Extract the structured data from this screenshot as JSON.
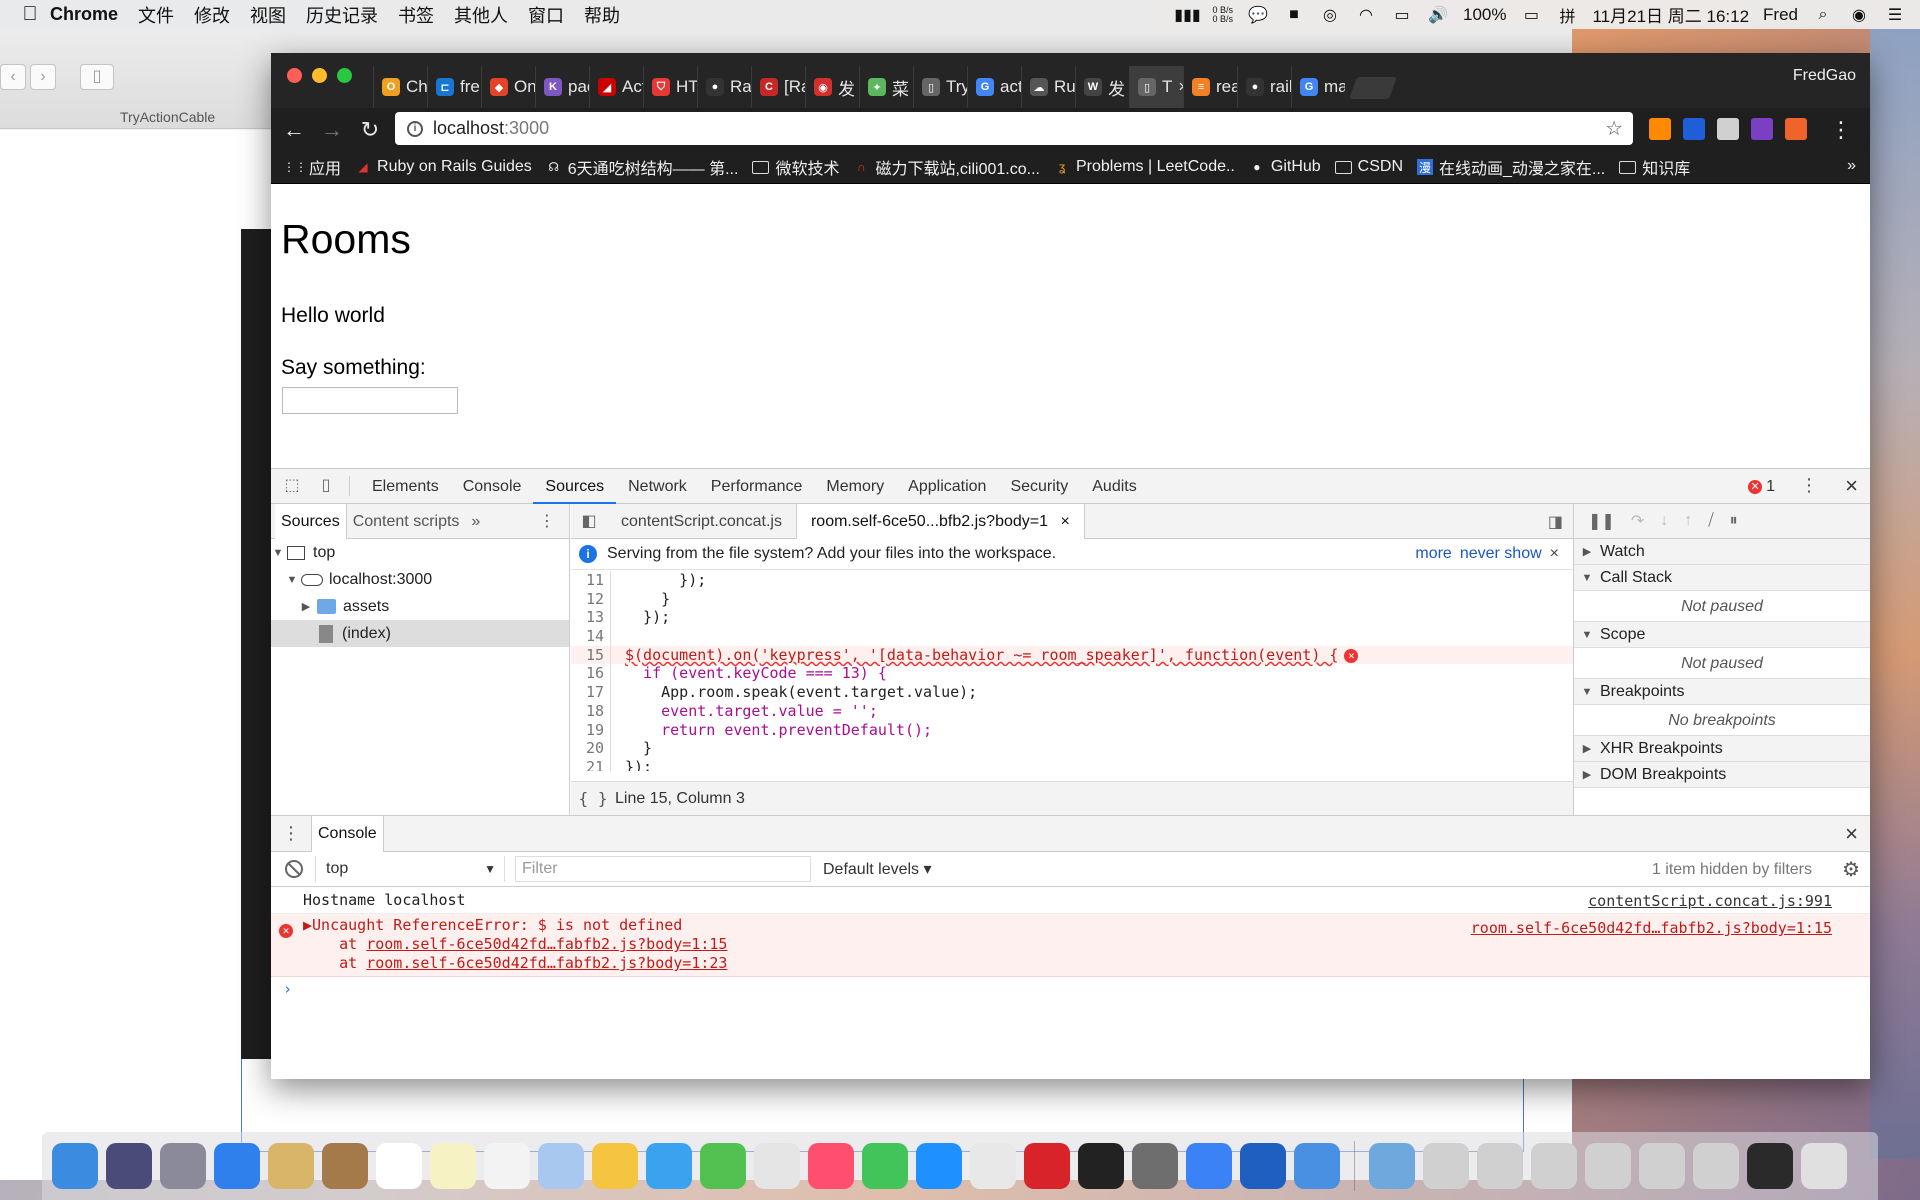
{
  "menubar": {
    "app": "Chrome",
    "items": [
      "文件",
      "修改",
      "视图",
      "历史记录",
      "书签",
      "其他人",
      "窗口",
      "帮助"
    ],
    "netspeed_up": "0 B/s",
    "netspeed_down": "0 B/s",
    "battery": "100%",
    "input_method": "拼",
    "datetime": "11月21日 周二  16:12",
    "user": "Fred"
  },
  "background_window": {
    "title": "TryActionCable"
  },
  "browser": {
    "profile": "FredGao",
    "tabs": [
      {
        "label": "Ch",
        "color": "#f0a020",
        "glyph": "O"
      },
      {
        "label": "fre",
        "color": "#1976d2",
        "glyph": "⊏"
      },
      {
        "label": "Onl",
        "color": "#e24329",
        "glyph": "◆"
      },
      {
        "label": "pac",
        "color": "#7e57c2",
        "glyph": "K"
      },
      {
        "label": "Act",
        "color": "#cc0000",
        "glyph": "◢"
      },
      {
        "label": "HT",
        "color": "#e53935",
        "glyph": "⛉"
      },
      {
        "label": "Rai",
        "color": "#333333",
        "glyph": "●"
      },
      {
        "label": "[Ra",
        "color": "#c62828",
        "glyph": "C"
      },
      {
        "label": "发",
        "color": "#d32f2f",
        "glyph": "◉"
      },
      {
        "label": "菜",
        "color": "#5cb85c",
        "glyph": "✦"
      },
      {
        "label": "Try",
        "color": "#666666",
        "glyph": "▯"
      },
      {
        "label": "act",
        "color": "#4285f4",
        "glyph": "G"
      },
      {
        "label": "Rul",
        "color": "#555555",
        "glyph": "☁"
      },
      {
        "label": "发",
        "color": "#444444",
        "glyph": "W"
      },
      {
        "label": "T",
        "color": "#666666",
        "glyph": "▯",
        "active": true
      },
      {
        "label": "rea",
        "color": "#f48024",
        "glyph": "≡"
      },
      {
        "label": "rail",
        "color": "#333333",
        "glyph": "●"
      },
      {
        "label": "ma",
        "color": "#4285f4",
        "glyph": "G"
      }
    ],
    "url_host": "localhost",
    "url_port": ":3000",
    "bookmarks": [
      {
        "label": "应用",
        "icon": "apps-grid"
      },
      {
        "label": "Ruby on Rails Guides",
        "icon": "rails-icon"
      },
      {
        "label": "6天通吃树结构—— 第...",
        "icon": "tree-icon"
      },
      {
        "label": "微软技术",
        "icon": "folder"
      },
      {
        "label": "磁力下载站,cili001.co...",
        "icon": "magnet-icon"
      },
      {
        "label": "Problems | LeetCode..",
        "icon": "leetcode-icon"
      },
      {
        "label": "GitHub",
        "icon": "github-icon"
      },
      {
        "label": "CSDN",
        "icon": "folder"
      },
      {
        "label": "在线动画_动漫之家在...",
        "icon": "anime-icon"
      },
      {
        "label": "知识库",
        "icon": "folder"
      }
    ]
  },
  "page": {
    "heading": "Rooms",
    "p1": "Hello world",
    "p2": "Say something:"
  },
  "devtools": {
    "tabs": [
      "Elements",
      "Console",
      "Sources",
      "Network",
      "Performance",
      "Memory",
      "Application",
      "Security",
      "Audits"
    ],
    "active_tab": "Sources",
    "error_count": "1",
    "nav_tabs": [
      "Sources",
      "Content scripts"
    ],
    "tree": {
      "top": "top",
      "host": "localhost:3000",
      "assets": "assets",
      "index": "(index)"
    },
    "editor_tabs": [
      "contentScript.concat.js",
      "room.self-6ce50...bfb2.js?body=1"
    ],
    "infobar": {
      "text": "Serving from the file system? Add your files into the workspace.",
      "more": "more",
      "never": "never show"
    },
    "code_lines": [
      {
        "n": "11",
        "text": "      });"
      },
      {
        "n": "12",
        "text": "    }"
      },
      {
        "n": "13",
        "text": "  });"
      },
      {
        "n": "14",
        "text": ""
      },
      {
        "n": "15",
        "text": "$(document).on('keypress', '[data-behavior ~= room_speaker]', function(event) {"
      },
      {
        "n": "16",
        "text": "  if (event.keyCode === 13) {"
      },
      {
        "n": "17",
        "text": "    App.room.speak(event.target.value);"
      },
      {
        "n": "18",
        "text": "    event.target.value = '';"
      },
      {
        "n": "19",
        "text": "    return event.preventDefault();"
      },
      {
        "n": "20",
        "text": "  }"
      },
      {
        "n": "21",
        "text": "});"
      }
    ],
    "status": "Line 15, Column 3",
    "debug": {
      "watch": "Watch",
      "call_stack": "Call Stack",
      "not_paused": "Not paused",
      "scope": "Scope",
      "breakpoints": "Breakpoints",
      "no_breakpoints": "No breakpoints",
      "xhr": "XHR Breakpoints",
      "dom": "DOM Breakpoints"
    },
    "console": {
      "tab": "Console",
      "context": "top",
      "filter_placeholder": "Filter",
      "levels": "Default levels",
      "hidden": "1 item hidden by filters",
      "log_text": "Hostname localhost",
      "log_src": "contentScript.concat.js:991",
      "error_text": "Uncaught ReferenceError: $ is not defined",
      "error_src": "room.self-6ce50d42fd…fabfb2.js?body=1:15",
      "at1_prefix": "    at ",
      "at1": "room.self-6ce50d42fd…fabfb2.js?body=1:15",
      "at2": "room.self-6ce50d42fd…fabfb2.js?body=1:23"
    }
  },
  "dock_colors": [
    "#3b8be0",
    "#4b4b7a",
    "#8a8a9a",
    "#2f80ed",
    "#d9b56a",
    "#a57a4a",
    "#ffffff",
    "#f7f2c4",
    "#f3f3f3",
    "#a8c8f0",
    "#f5c542",
    "#3aa3f0",
    "#52c152",
    "#e5e5e5",
    "#ff4f6e",
    "#43c45a",
    "#1e90ff",
    "#e8e8e8",
    "#d8232a",
    "#222222",
    "#6e6e6e",
    "#3b82f6",
    "#1f5fbf",
    "#4a90e2",
    "#6fa8dc",
    "#d0d0d0",
    "#d0d0d0",
    "#d0d0d0",
    "#d0d0d0",
    "#d0d0d0",
    "#d0d0d0",
    "#2a2a2a",
    "#e0e0e0"
  ]
}
